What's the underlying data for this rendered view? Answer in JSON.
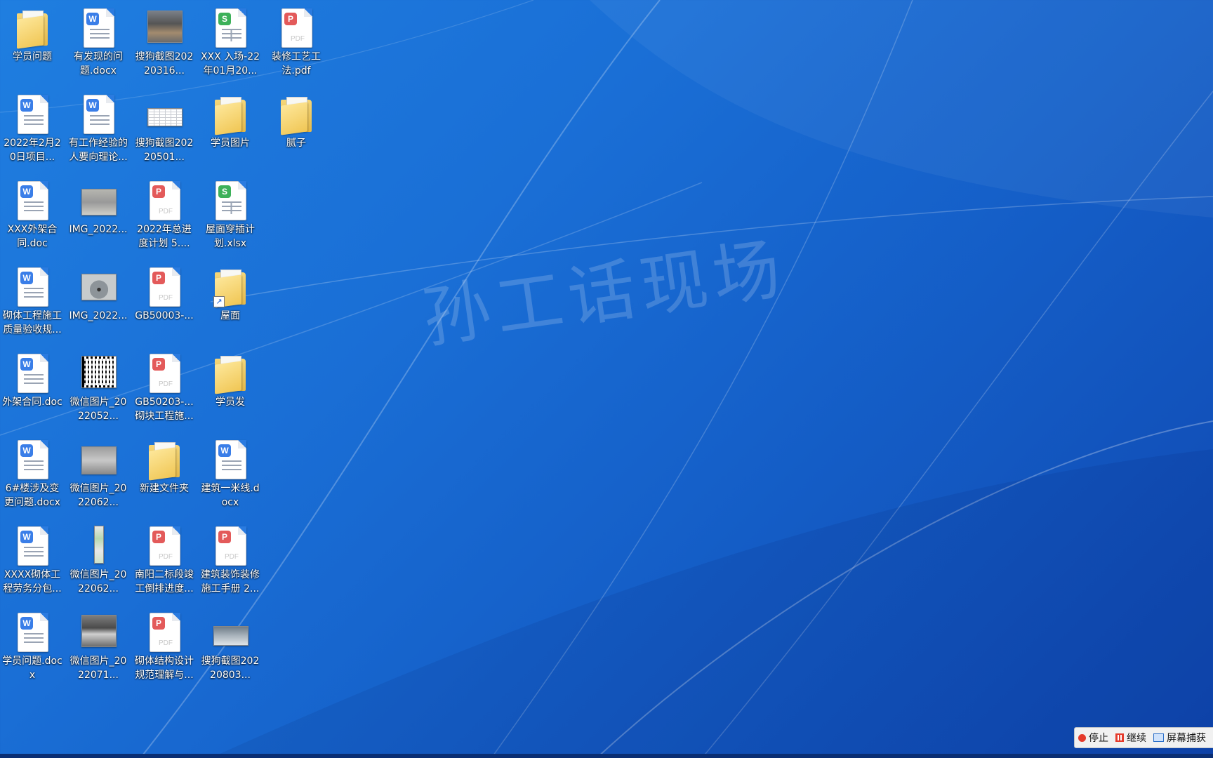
{
  "desktop": {
    "icons": [
      {
        "label": "学员问题",
        "type": "folder"
      },
      {
        "label": "有发现的问题.docx",
        "type": "word"
      },
      {
        "label": "搜狗截图20220316...",
        "type": "image"
      },
      {
        "label": "XXX 入场-22年01月20...",
        "type": "sheet"
      },
      {
        "label": "装修工艺工法.pdf",
        "type": "pdf"
      },
      {
        "label": "2022年2月20日项目...",
        "type": "word"
      },
      {
        "label": "有工作经验的人要向理论...",
        "type": "word"
      },
      {
        "label": "搜狗截图20220501...",
        "type": "image"
      },
      {
        "label": "学员图片",
        "type": "folder"
      },
      {
        "label": "腻子",
        "type": "folder"
      },
      {
        "label": "XXX外架合同.doc",
        "type": "word"
      },
      {
        "label": "IMG_2022...",
        "type": "image"
      },
      {
        "label": "2022年总进度计划 5....",
        "type": "pdf"
      },
      {
        "label": "屋面穿插计划.xlsx",
        "type": "sheet"
      },
      {
        "label": "砌体工程施工质量验收规...",
        "type": "word"
      },
      {
        "label": "IMG_2022...",
        "type": "image"
      },
      {
        "label": "GB50003-...",
        "type": "pdf"
      },
      {
        "label": "屋面",
        "type": "folder-shortcut"
      },
      {
        "label": "外架合同.doc",
        "type": "word"
      },
      {
        "label": "微信图片_2022052...",
        "type": "image"
      },
      {
        "label": "GB50203-...砌块工程施...",
        "type": "pdf"
      },
      {
        "label": "学员发",
        "type": "folder"
      },
      {
        "label": "6#楼涉及变更问题.docx",
        "type": "word"
      },
      {
        "label": "微信图片_2022062...",
        "type": "image"
      },
      {
        "label": "新建文件夹",
        "type": "folder"
      },
      {
        "label": "建筑一米线.docx",
        "type": "word"
      },
      {
        "label": "XXXX砌体工程劳务分包...",
        "type": "word"
      },
      {
        "label": "微信图片_2022062...",
        "type": "image"
      },
      {
        "label": "南阳二标段竣工倒排进度...",
        "type": "pdf"
      },
      {
        "label": "建筑装饰装修施工手册 2...",
        "type": "pdf"
      },
      {
        "label": "学员问题.docx",
        "type": "word"
      },
      {
        "label": "微信图片_2022071...",
        "type": "image"
      },
      {
        "label": "砌体结构设计规范理解与...",
        "type": "pdf"
      },
      {
        "label": "搜狗截图20220803...",
        "type": "image"
      }
    ]
  },
  "watermark": "孙工话现场",
  "recorder": {
    "stop_label": "停止",
    "continue_label": "继续",
    "capture_label": "屏幕捕获"
  },
  "colors": {
    "wallpaper_top": "#1f7ee0",
    "wallpaper_bottom": "#0f47b0",
    "word_badge": "#3a7ee8",
    "pdf_badge": "#e35a5a",
    "sheet_badge": "#3db15a",
    "folder": "#f0c654"
  }
}
